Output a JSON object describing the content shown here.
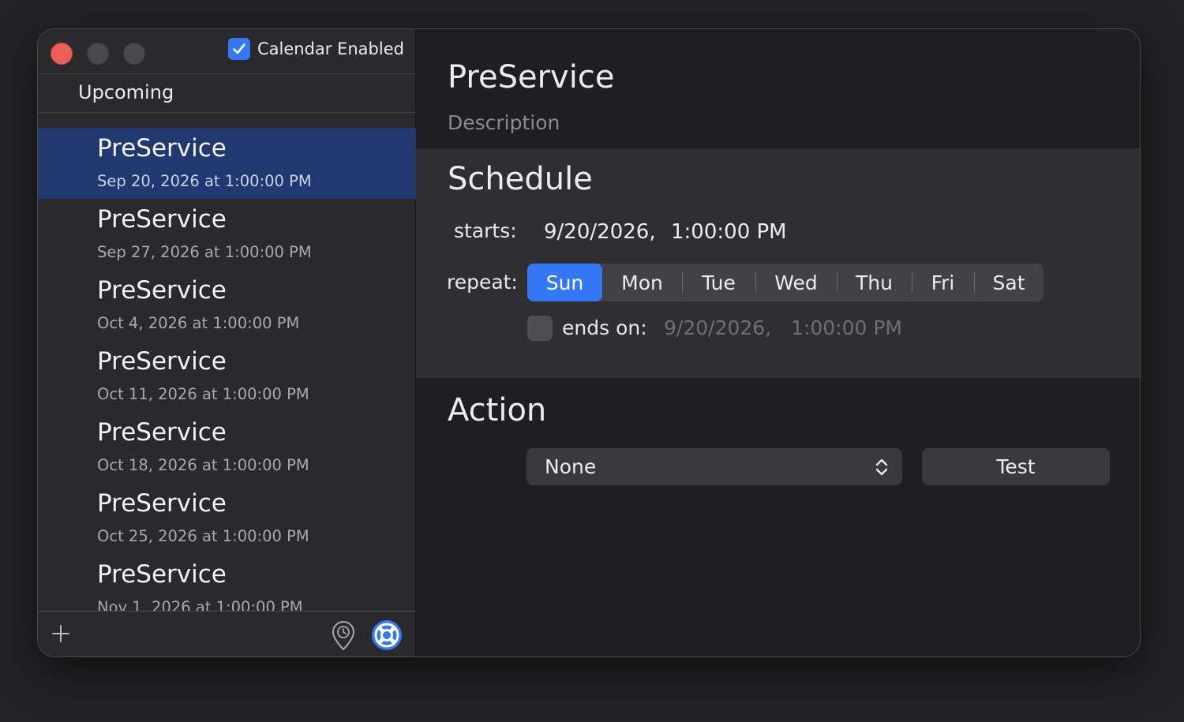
{
  "sidebar": {
    "calendar_enabled_label": "Calendar Enabled",
    "calendar_enabled_checked": true,
    "list_header": "Upcoming",
    "events": [
      {
        "title": "PreService",
        "date": "Sep 20, 2026 at 1:00:00 PM",
        "selected": true
      },
      {
        "title": "PreService",
        "date": "Sep 27, 2026 at 1:00:00 PM"
      },
      {
        "title": "PreService",
        "date": "Oct 4, 2026 at 1:00:00 PM"
      },
      {
        "title": "PreService",
        "date": "Oct 11, 2026 at 1:00:00 PM"
      },
      {
        "title": "PreService",
        "date": "Oct 18, 2026 at 1:00:00 PM"
      },
      {
        "title": "PreService",
        "date": "Oct 25, 2026 at 1:00:00 PM"
      },
      {
        "title": "PreService",
        "date": "Nov 1, 2026 at 1:00:00 PM"
      }
    ],
    "footer_icons": [
      "plus-icon",
      "location-pin-icon",
      "lifebuoy-icon"
    ]
  },
  "detail": {
    "name": "PreService",
    "description_placeholder": "Description",
    "schedule": {
      "title": "Schedule",
      "starts_label": "starts:",
      "starts_date": "9/20/2026,",
      "starts_time": "1:00:00 PM",
      "repeat_label": "repeat:",
      "days": [
        "Sun",
        "Mon",
        "Tue",
        "Wed",
        "Thu",
        "Fri",
        "Sat"
      ],
      "selected_day": "Sun",
      "ends_label": "ends on:",
      "ends_checked": false,
      "ends_date": "9/20/2026,",
      "ends_time": "1:00:00 PM"
    },
    "action": {
      "title": "Action",
      "selected": "None",
      "test_label": "Test"
    }
  },
  "colors": {
    "accent": "#3478f6",
    "selection": "#21396f",
    "close": "#ec5f58"
  }
}
